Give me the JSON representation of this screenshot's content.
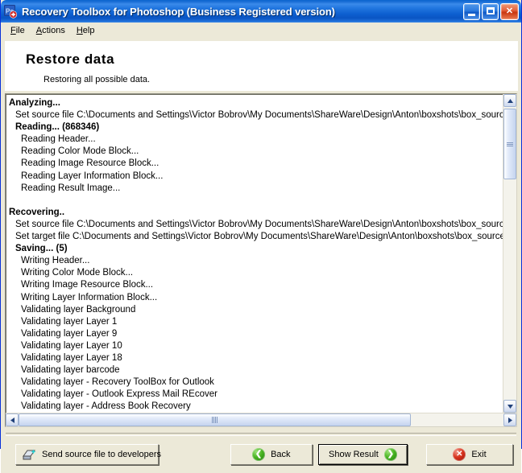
{
  "window": {
    "title": "Recovery Toolbox for Photoshop (Business Registered version)",
    "icon": "photoshop-repair-icon",
    "caption": {
      "minimize_label": "Minimize",
      "maximize_label": "Maximize",
      "close_label": "Close"
    }
  },
  "menubar": {
    "items": [
      {
        "label": "File",
        "accel": "F"
      },
      {
        "label": "Actions",
        "accel": "A"
      },
      {
        "label": "Help",
        "accel": "H"
      }
    ]
  },
  "header": {
    "title": "Restore data",
    "subtitle": "Restoring all possible data."
  },
  "log": {
    "lines": [
      {
        "text": "Analyzing...",
        "bold": true,
        "indent": 0
      },
      {
        "text": "Set source file C:\\Documents and Settings\\Victor Bobrov\\My Documents\\ShareWare\\Design\\Anton\\boxshots\\box_source_sel",
        "bold": false,
        "indent": 1
      },
      {
        "text": "Reading... (868346)",
        "bold": true,
        "indent": 1
      },
      {
        "text": "Reading Header...",
        "bold": false,
        "indent": 2
      },
      {
        "text": "Reading Color Mode Block...",
        "bold": false,
        "indent": 2
      },
      {
        "text": "Reading Image Resource Block...",
        "bold": false,
        "indent": 2
      },
      {
        "text": "Reading Layer Information Block...",
        "bold": false,
        "indent": 2
      },
      {
        "text": "Reading Result Image...",
        "bold": false,
        "indent": 2
      },
      {
        "text": "",
        "bold": false,
        "indent": 0
      },
      {
        "text": "Recovering..",
        "bold": true,
        "indent": 0
      },
      {
        "text": "Set source file C:\\Documents and Settings\\Victor Bobrov\\My Documents\\ShareWare\\Design\\Anton\\boxshots\\box_source_sel",
        "bold": false,
        "indent": 1
      },
      {
        "text": "Set target file C:\\Documents and Settings\\Victor Bobrov\\My Documents\\ShareWare\\Design\\Anton\\boxshots\\box_source_set",
        "bold": false,
        "indent": 1
      },
      {
        "text": "Saving... (5)",
        "bold": true,
        "indent": 1
      },
      {
        "text": "Writing Header...",
        "bold": false,
        "indent": 2
      },
      {
        "text": "Writing Color Mode Block...",
        "bold": false,
        "indent": 2
      },
      {
        "text": "Writing Image Resource Block...",
        "bold": false,
        "indent": 2
      },
      {
        "text": "Writing Layer Information Block...",
        "bold": false,
        "indent": 2
      },
      {
        "text": "Validating layer Background",
        "bold": false,
        "indent": 2
      },
      {
        "text": "Validating layer Layer 1",
        "bold": false,
        "indent": 2
      },
      {
        "text": "Validating layer Layer 9",
        "bold": false,
        "indent": 2
      },
      {
        "text": "Validating layer Layer 10",
        "bold": false,
        "indent": 2
      },
      {
        "text": "Validating layer Layer 18",
        "bold": false,
        "indent": 2
      },
      {
        "text": "Validating layer barcode",
        "bold": false,
        "indent": 2
      },
      {
        "text": "Validating layer - Recovery ToolBox for Outlook",
        "bold": false,
        "indent": 2
      },
      {
        "text": "Validating layer - Outlook Express Mail REcover",
        "bold": false,
        "indent": 2
      },
      {
        "text": "Validating layer - Address Book Recovery",
        "bold": false,
        "indent": 2
      }
    ],
    "scrollbars": {
      "vertical_up": "▲",
      "vertical_down": "▼",
      "horizontal_left": "◀",
      "horizontal_right": "▶"
    }
  },
  "buttons": {
    "send": {
      "label": "Send source file to developers",
      "icon": "send-file-icon"
    },
    "back": {
      "label": "Back",
      "icon": "arrow-left-circle-icon"
    },
    "show_result": {
      "label": "Show Result",
      "icon": "arrow-right-circle-icon",
      "focused": true
    },
    "exit": {
      "label": "Exit",
      "icon": "close-circle-icon"
    }
  },
  "colors": {
    "title_bar_blue": "#0a55c4",
    "window_face": "#ece9d8",
    "accent_green": "#48b321",
    "accent_red": "#d8331d",
    "scrollbar_thumb": "#c5d4ef"
  }
}
